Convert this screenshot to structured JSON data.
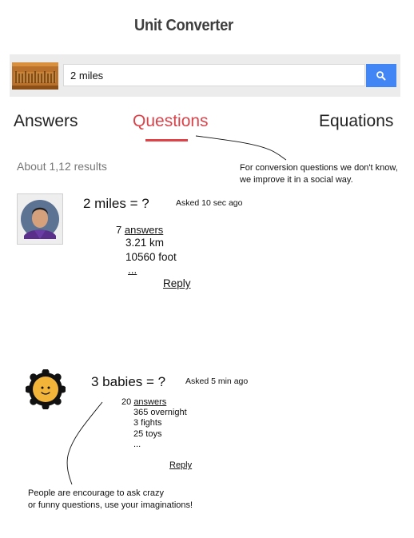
{
  "app": {
    "title": "Unit Converter"
  },
  "search": {
    "query": "2 miles",
    "icon": "ruler-icon",
    "button_icon": "search-icon",
    "accent_color": "#4285f4"
  },
  "tabs": [
    {
      "label": "Answers",
      "active": false
    },
    {
      "label": "Questions",
      "active": true
    },
    {
      "label": "Equations",
      "active": false
    }
  ],
  "active_tab_color": "#d9434a",
  "results": {
    "count_text": "About 1,12  results"
  },
  "annotations": {
    "conversion_note_line1": "For conversion questions we don't know,",
    "conversion_note_line2": "we improve it in a social way.",
    "crazy_note_line1": "People are encourage to ask crazy",
    "crazy_note_line2": "or funny questions, use your imaginations!"
  },
  "questions": [
    {
      "title": "2 miles = ?",
      "asked": "Asked 10 sec ago",
      "answers_count": "7",
      "answers_label": "answers",
      "answers": [
        "3.21 km",
        "10560 foot"
      ],
      "more": "...",
      "reply": "Reply",
      "avatar": "user-photo"
    },
    {
      "title": "3 babies = ?",
      "asked": "Asked 5 min ago",
      "answers_count": "20",
      "answers_label": "answers",
      "answers": [
        "365 overnight",
        "3 fights",
        "25 toys"
      ],
      "more": "...",
      "reply": "Reply",
      "avatar": "sun-icon"
    }
  ]
}
